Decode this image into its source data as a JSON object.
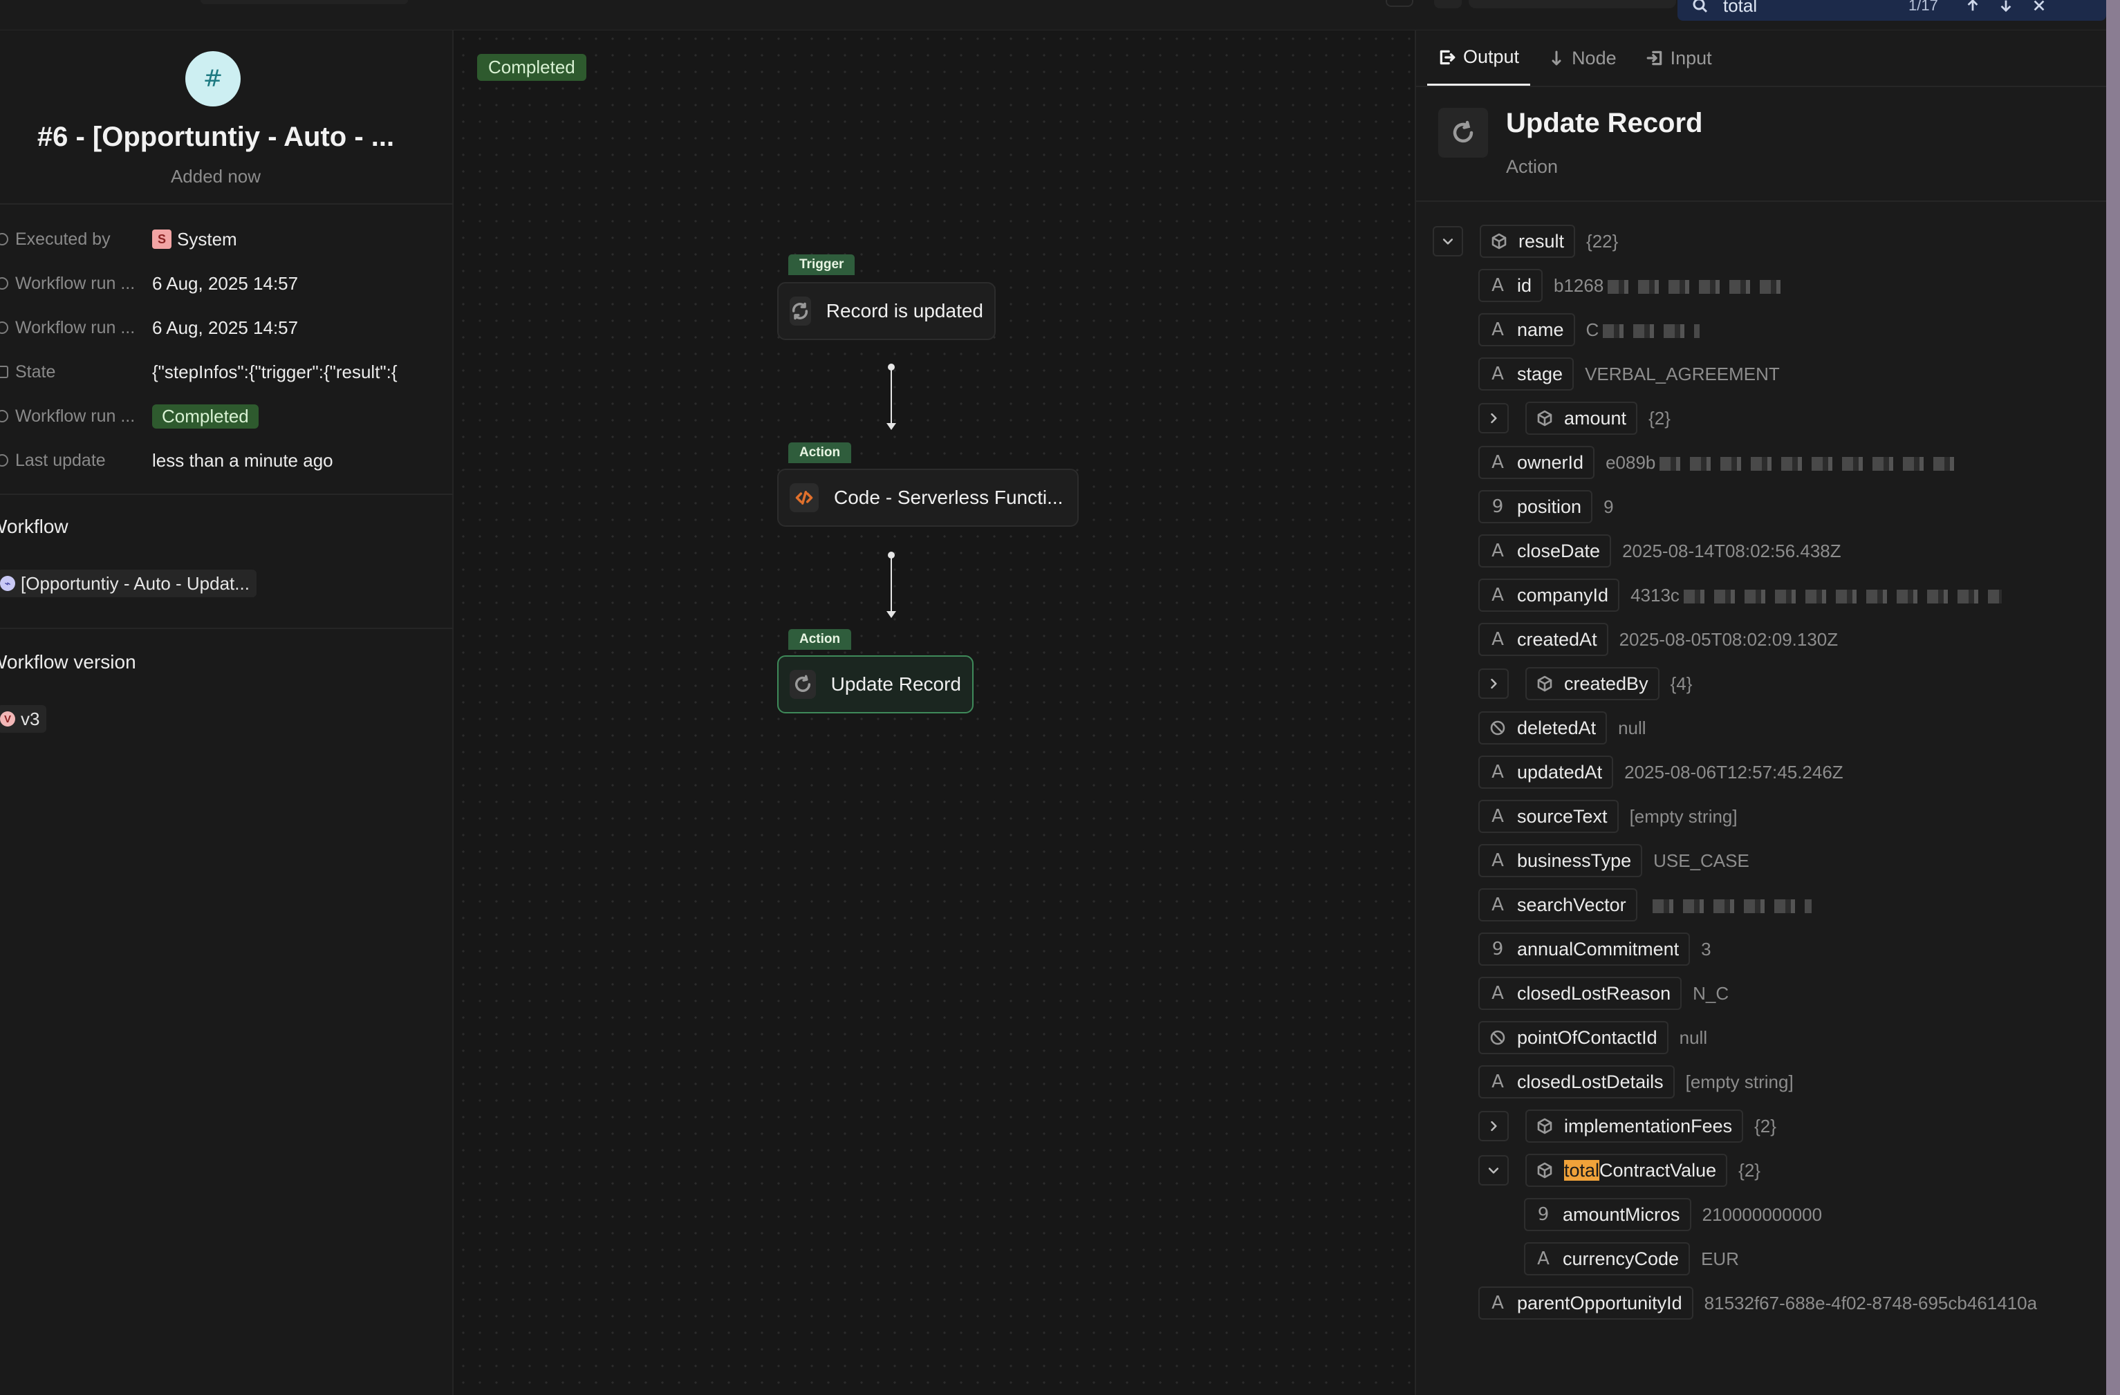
{
  "search": {
    "value": "total",
    "count": "1/17"
  },
  "run": {
    "avatar_glyph": "#",
    "title": "#6 - [Opportuntiy - Auto - ...",
    "subtitle": "Added now",
    "fields": [
      {
        "label": "Executed by",
        "value": "System",
        "badge": "S"
      },
      {
        "label": "Workflow run ...",
        "value": "6 Aug, 2025 14:57"
      },
      {
        "label": "Workflow run ...",
        "value": "6 Aug, 2025 14:57"
      },
      {
        "label": "State",
        "value": "{\"stepInfos\":{\"trigger\":{\"result\":{"
      },
      {
        "label": "Workflow run ...",
        "value": "Completed"
      },
      {
        "label": "Last update",
        "value": "less than a minute ago"
      }
    ],
    "workflow_heading": "Workflow",
    "workflow_chip": "[Opportuntiy - Auto - Updat...",
    "version_heading": "Workflow version",
    "version_chip": "v3",
    "version_badge": "V"
  },
  "canvas": {
    "status": "Completed",
    "nodes": [
      {
        "tag": "Trigger",
        "label": "Record is updated",
        "icon": "sync-icon"
      },
      {
        "tag": "Action",
        "label": "Code - Serverless Functi...",
        "icon": "code-icon"
      },
      {
        "tag": "Action",
        "label": "Update Record",
        "icon": "refresh-icon"
      }
    ]
  },
  "panel": {
    "tabs": [
      "Output",
      "Node",
      "Input"
    ],
    "title": "Update Record",
    "subtitle": "Action",
    "tree": {
      "root_key": "result",
      "root_count": "{22}",
      "fields": [
        {
          "key": "id",
          "type": "text",
          "value": "b1268"
        },
        {
          "key": "name",
          "type": "text",
          "value": "C"
        },
        {
          "key": "stage",
          "type": "text",
          "value": "VERBAL_AGREEMENT"
        },
        {
          "key": "amount",
          "type": "object",
          "value": "{2}"
        },
        {
          "key": "ownerId",
          "type": "text",
          "value": "e089b"
        },
        {
          "key": "position",
          "type": "number",
          "value": "9"
        },
        {
          "key": "closeDate",
          "type": "text",
          "value": "2025-08-14T08:02:56.438Z"
        },
        {
          "key": "companyId",
          "type": "text",
          "value": "4313c"
        },
        {
          "key": "createdAt",
          "type": "text",
          "value": "2025-08-05T08:02:09.130Z"
        },
        {
          "key": "createdBy",
          "type": "object",
          "value": "{4}"
        },
        {
          "key": "deletedAt",
          "type": "null",
          "value": "null"
        },
        {
          "key": "updatedAt",
          "type": "text",
          "value": "2025-08-06T12:57:45.246Z"
        },
        {
          "key": "sourceText",
          "type": "text",
          "value": "[empty string]"
        },
        {
          "key": "businessType",
          "type": "text",
          "value": "USE_CASE"
        },
        {
          "key": "searchVector",
          "type": "text",
          "value": ""
        },
        {
          "key": "annualCommitment",
          "type": "number",
          "value": "3"
        },
        {
          "key": "closedLostReason",
          "type": "text",
          "value": "N_C"
        },
        {
          "key": "pointOfContactId",
          "type": "null",
          "value": "null"
        },
        {
          "key": "closedLostDetails",
          "type": "text",
          "value": "[empty string]"
        },
        {
          "key": "implementationFees",
          "type": "object",
          "value": "{2}"
        },
        {
          "key_highlight": "total",
          "key_rest": "ContractValue",
          "type": "object",
          "value": "{2}"
        },
        {
          "key": "amountMicros",
          "type": "number",
          "value": "210000000000"
        },
        {
          "key": "currencyCode",
          "type": "text",
          "value": "EUR"
        },
        {
          "key": "parentOpportunityId",
          "type": "text",
          "value": "81532f67-688e-4f02-8748-695cb461410a"
        }
      ]
    }
  },
  "colors": {
    "background": "#171717",
    "completed_badge": "#2e5a2e",
    "node_tag": "#2f5d3c",
    "active_node_border": "#3f8a5a",
    "search_bar": "#1c2a4a",
    "highlight": "#f0a23a",
    "hash_avatar": "#cdeff2"
  }
}
